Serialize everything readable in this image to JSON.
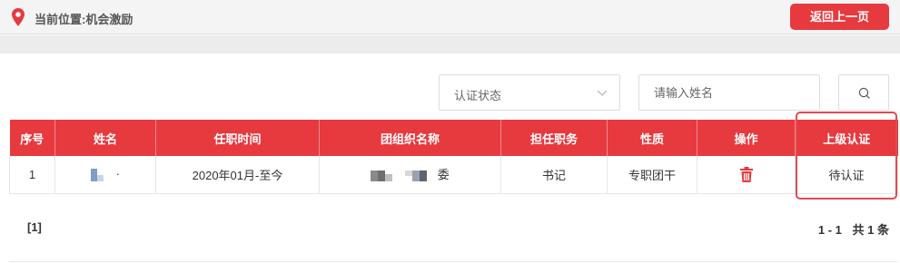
{
  "header": {
    "location_text": "当前位置:机会激励",
    "back_label": "返回上一页"
  },
  "filters": {
    "status_select_value": "认证状态",
    "name_placeholder": "请输入姓名"
  },
  "table": {
    "columns": [
      "序号",
      "姓名",
      "任职时间",
      "团组织名称",
      "担任职务",
      "性质",
      "操作",
      "上级认证"
    ],
    "rows": [
      {
        "index": "1",
        "name_suffix": "·",
        "tenure": "2020年01月-至今",
        "org_suffix": "委",
        "position": "书记",
        "nature": "专职团干",
        "status": "待认证"
      }
    ]
  },
  "pagination": {
    "page_label": "[1]",
    "range_label": "1 - 1",
    "total_label": "共 1 条"
  },
  "colors": {
    "accent": "#e63a3f",
    "highlight_border": "#e14a4f"
  },
  "icons": [
    "location-pin-icon",
    "chevron-down-icon",
    "search-icon",
    "trash-icon"
  ]
}
